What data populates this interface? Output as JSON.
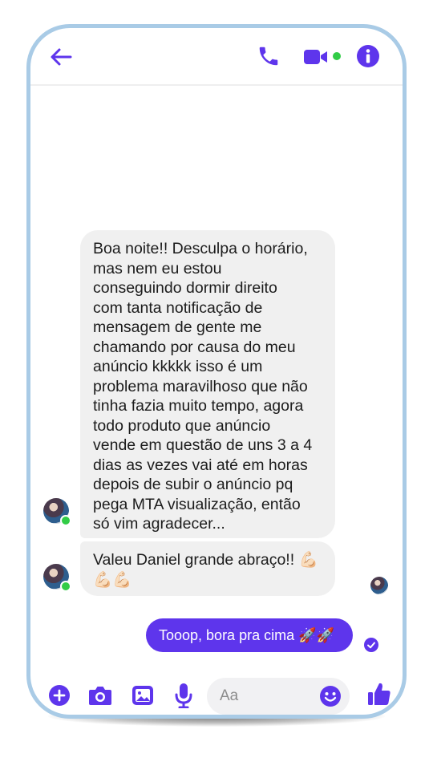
{
  "colors": {
    "accent": "#5e35ec",
    "online": "#31cc46",
    "bubble_received": "#f0f0f0",
    "frame": "#a9cbe6"
  },
  "header": {
    "icons": [
      "back-arrow-icon",
      "phone-icon",
      "video-camera-icon",
      "info-icon"
    ]
  },
  "messages": {
    "received": [
      {
        "text": "Boa noite!! Desculpa o horário,\nmas nem eu estou\nconseguindo dormir direito\ncom tanta notificação de\nmensagem de gente me\nchamando por causa do meu\nanúncio kkkkk isso é um\nproblema maravilhoso que não\ntinha fazia muito tempo, agora\ntodo produto que anúncio\nvende em questão de uns 3 a 4\ndias as vezes vai até em horas\ndepois de subir o anúncio pq\npega MTA visualização, então\nsó vim agradecer..."
      },
      {
        "text": "Valeu Daniel grande abraço!! 💪🏻\n💪🏻💪🏻"
      }
    ],
    "sent": [
      {
        "text": "Tooop, bora pra cima  🚀🚀"
      }
    ]
  },
  "composer": {
    "placeholder": "Aa",
    "icons": [
      "plus-icon",
      "camera-icon",
      "gallery-icon",
      "microphone-icon",
      "emoji-icon",
      "thumbs-up-icon"
    ]
  }
}
